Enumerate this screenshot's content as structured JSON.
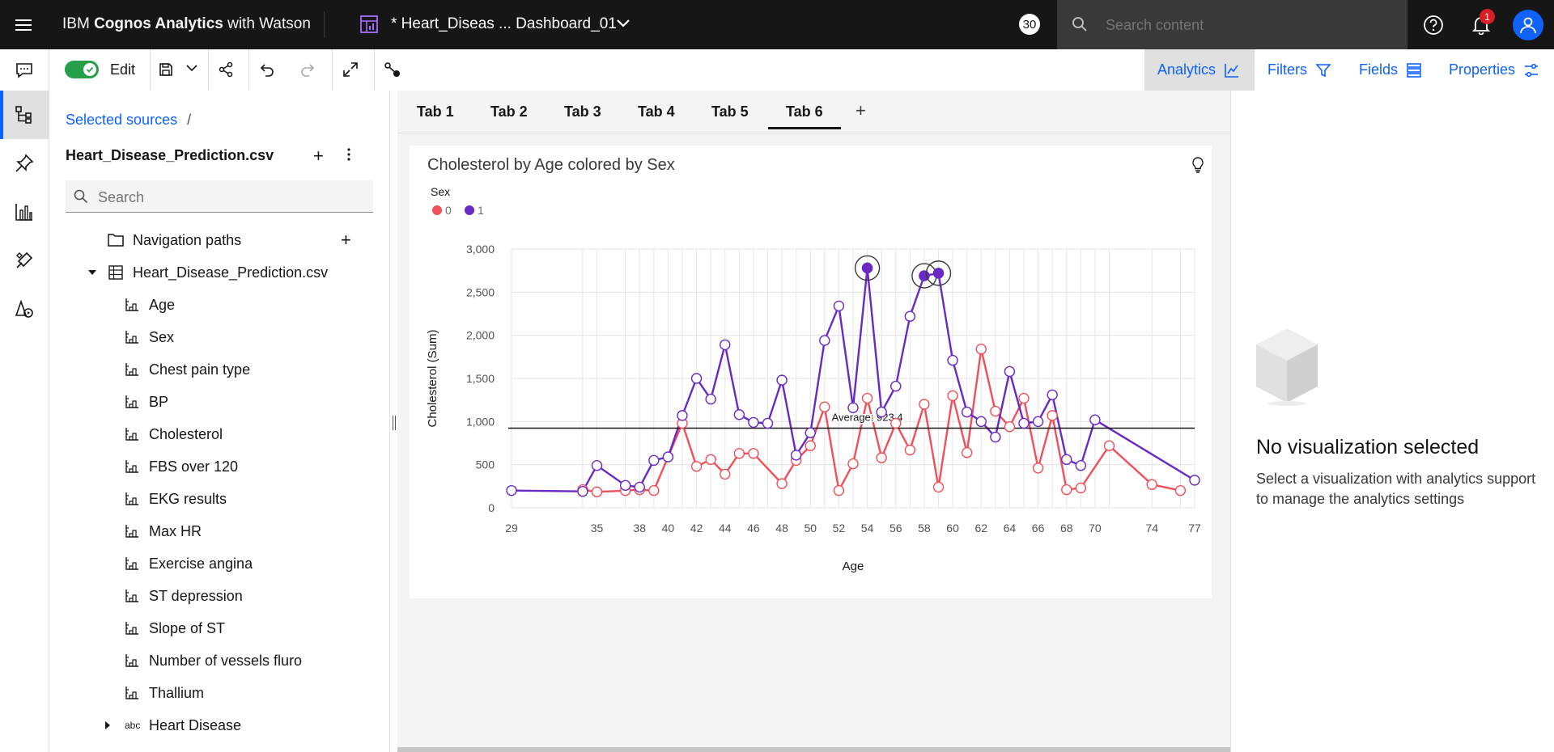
{
  "app": {
    "brand_prefix": "IBM ",
    "brand_bold": "Cognos Analytics",
    "brand_suffix": " with Watson",
    "dashboard_name": "* Heart_Diseas ... Dashboard_01",
    "counter": "30",
    "search_placeholder": "Search content",
    "notification_count": "1"
  },
  "toolbar": {
    "edit_label": "Edit",
    "analytics_label": "Analytics",
    "filters_label": "Filters",
    "fields_label": "Fields",
    "properties_label": "Properties"
  },
  "source_panel": {
    "breadcrumb": "Selected sources",
    "breadcrumb_sep": "/",
    "file_name": "Heart_Disease_Prediction.csv",
    "search_placeholder": "Search",
    "navigation_paths": "Navigation paths",
    "table_name": "Heart_Disease_Prediction.csv",
    "fields": [
      "Age",
      "Sex",
      "Chest pain type",
      "BP",
      "Cholesterol",
      "FBS over 120",
      "EKG results",
      "Max HR",
      "Exercise angina",
      "ST depression",
      "Slope of ST",
      "Number of vessels fluro",
      "Thallium"
    ],
    "last_field": "Heart Disease",
    "last_field_type": "abc"
  },
  "tabs": [
    "Tab 1",
    "Tab 2",
    "Tab 3",
    "Tab 4",
    "Tab 5",
    "Tab 6"
  ],
  "active_tab": 5,
  "widget": {
    "title": "Cholesterol by Age colored by Sex"
  },
  "chart_data": {
    "type": "line",
    "title": "Cholesterol by Age colored by Sex",
    "xlabel": "Age",
    "ylabel": "Cholesterol (Sum)",
    "legend_title": "Sex",
    "legend_position": "top-left",
    "grid": true,
    "ylim": [
      0,
      3000
    ],
    "yticks": [
      "0",
      "500",
      "1,000",
      "1,500",
      "2,000",
      "2,500",
      "3,000"
    ],
    "xticks": [
      29,
      35,
      38,
      40,
      42,
      44,
      46,
      48,
      50,
      52,
      54,
      56,
      58,
      60,
      62,
      64,
      66,
      68,
      70,
      74,
      77
    ],
    "x": [
      29,
      34,
      35,
      37,
      38,
      39,
      40,
      41,
      42,
      43,
      44,
      45,
      46,
      47,
      48,
      49,
      50,
      51,
      52,
      53,
      54,
      55,
      56,
      57,
      58,
      59,
      60,
      61,
      62,
      63,
      64,
      65,
      66,
      67,
      68,
      69,
      70,
      71,
      74,
      76,
      77
    ],
    "series": [
      {
        "name": "0",
        "color": "#f0505a",
        "values": [
          null,
          210,
          185,
          200,
          210,
          200,
          590,
          980,
          480,
          560,
          390,
          630,
          630,
          null,
          280,
          550,
          720,
          1170,
          200,
          510,
          1270,
          580,
          980,
          670,
          1200,
          240,
          1300,
          640,
          1840,
          1120,
          940,
          1270,
          460,
          1070,
          210,
          230,
          null,
          720,
          270,
          200,
          null
        ]
      },
      {
        "name": "1",
        "color": "#6929c4",
        "values": [
          200,
          190,
          490,
          260,
          240,
          550,
          590,
          1070,
          1500,
          1260,
          1890,
          1080,
          990,
          980,
          1480,
          610,
          870,
          1940,
          2340,
          1160,
          2780,
          1110,
          1410,
          2220,
          2690,
          2720,
          1710,
          1110,
          1000,
          820,
          1580,
          980,
          1000,
          1310,
          560,
          490,
          1020,
          null,
          null,
          null,
          320
        ]
      }
    ],
    "highlighted": [
      54,
      58,
      59
    ],
    "reference_line": {
      "value": 923.4,
      "label": "Average: 923.4"
    }
  },
  "right_panel": {
    "title": "No visualization selected",
    "description": "Select a visualization with analytics support to manage the analytics settings"
  }
}
